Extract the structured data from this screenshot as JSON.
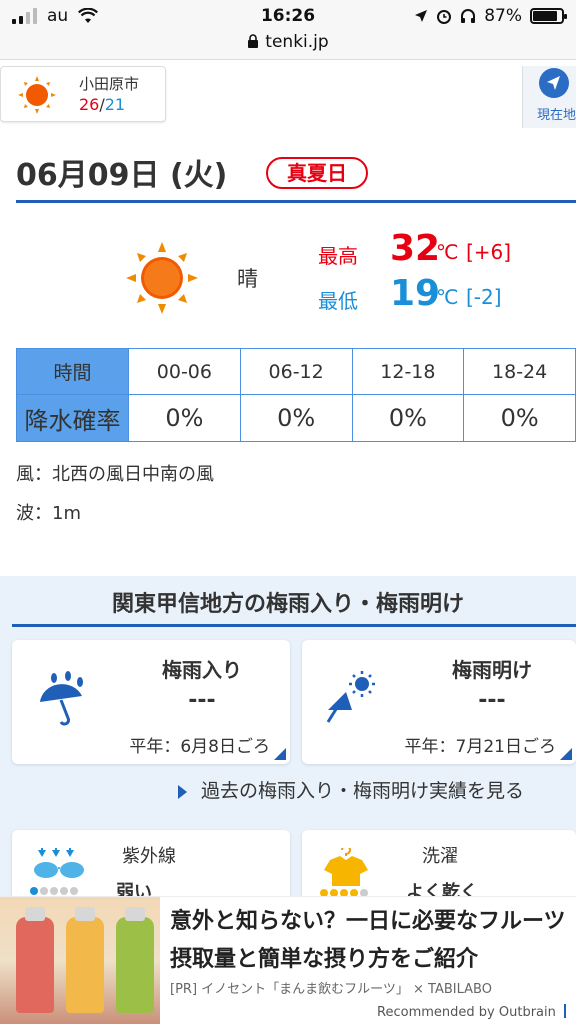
{
  "status_bar": {
    "carrier": "au",
    "time": "16:26",
    "battery": "87%",
    "battery_level": 0.87
  },
  "url_bar": {
    "domain": "tenki.jp"
  },
  "city": {
    "name": "小田原市",
    "high": "26",
    "separator": "/",
    "low": "21"
  },
  "location_button": {
    "label": "現在地"
  },
  "forecast": {
    "date": "06月09日 (火)",
    "badge": "真夏日",
    "weather": "晴",
    "high_label": "最高",
    "high_temp": "32",
    "high_diff": "[+6]",
    "low_label": "最低",
    "low_temp": "19",
    "low_diff": "[-2]",
    "unit": "℃"
  },
  "precip": {
    "header_label": "時間",
    "value_label": "降水確率",
    "periods": [
      "00-06",
      "06-12",
      "12-18",
      "18-24"
    ],
    "values": [
      "0%",
      "0%",
      "0%",
      "0%"
    ]
  },
  "wind": "風：北西の風日中南の風",
  "wave": "波：1m",
  "rainy_season": {
    "title": "関東甲信地方の梅雨入り・梅雨明け",
    "start": {
      "title": "梅雨入り",
      "value": "---",
      "normal": "平年：6月8日ごろ"
    },
    "end": {
      "title": "梅雨明け",
      "value": "---",
      "normal": "平年：7月21日ごろ"
    },
    "past_link": "過去の梅雨入り・梅雨明け実績を見る"
  },
  "indices": [
    {
      "title": "紫外線",
      "value": "弱い"
    },
    {
      "title": "洗濯",
      "value": "よく乾く"
    }
  ],
  "ad": {
    "title": "意外と知らない？一日に必要なフルーツ摂取量と簡単な摂り方をご紹介",
    "source": "[PR] イノセント「まんま飲むフルーツ」 × TABILABO",
    "recommended": "Recommended by Outbrain"
  },
  "colors": {
    "accent": "#1f5fb8",
    "high": "#e60012",
    "low": "#1a8fd8",
    "table_header": "#5aa0ea"
  }
}
